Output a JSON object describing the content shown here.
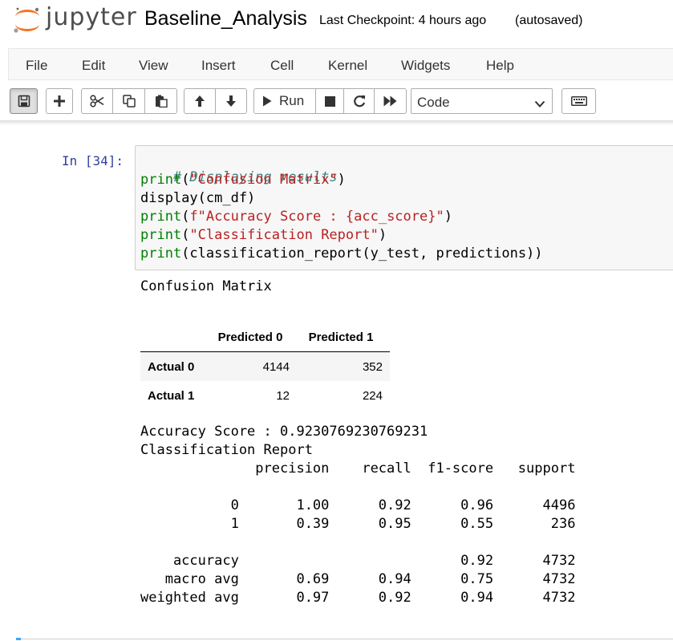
{
  "header": {
    "logo_text": "jupyter",
    "notebook_name": "Baseline_Analysis",
    "checkpoint": "Last Checkpoint: 4 hours ago",
    "autosave": "(autosaved)"
  },
  "menubar": {
    "items": [
      "File",
      "Edit",
      "View",
      "Insert",
      "Cell",
      "Kernel",
      "Widgets",
      "Help"
    ]
  },
  "toolbar": {
    "run_label": "Run",
    "cell_type": "Code",
    "icons": [
      "save-icon",
      "plus-icon",
      "cut-icon",
      "copy-icon",
      "paste-icon",
      "arrow-up-icon",
      "arrow-down-icon",
      "play-icon",
      "stop-icon",
      "restart-icon",
      "fast-forward-icon",
      "chevron-down-icon",
      "keyboard-icon"
    ]
  },
  "cell": {
    "prompt": "In [34]:",
    "code": {
      "line1": "# Displaying results",
      "line2_fn": "print",
      "line2_str": "\"Confusion Matrix\"",
      "line3": "display(cm_df)",
      "line4_fn": "print",
      "line4_str": "f\"Accuracy Score : {acc_score}\"",
      "line5_fn": "print",
      "line5_str": "\"Classification Report\"",
      "line6_fn": "print",
      "line6_rest": "(classification_report(y_test, predictions))"
    }
  },
  "output": {
    "confusion_title": "Confusion Matrix",
    "table": {
      "columns": [
        "Predicted 0",
        "Predicted 1"
      ],
      "rows": [
        {
          "label": "Actual 0",
          "values": [
            "4144",
            "352"
          ]
        },
        {
          "label": "Actual 1",
          "values": [
            "12",
            "224"
          ]
        }
      ]
    },
    "accuracy_line": "Accuracy Score : 0.9230769230769231",
    "report_title": "Classification Report",
    "report_lines": [
      "              precision    recall  f1-score   support",
      "",
      "           0       1.00      0.92      0.96      4496",
      "           1       0.39      0.95      0.55       236",
      "",
      "    accuracy                           0.92      4732",
      "   macro avg       0.69      0.94      0.75      4732",
      "weighted avg       0.97      0.92      0.94      4732"
    ]
  }
}
